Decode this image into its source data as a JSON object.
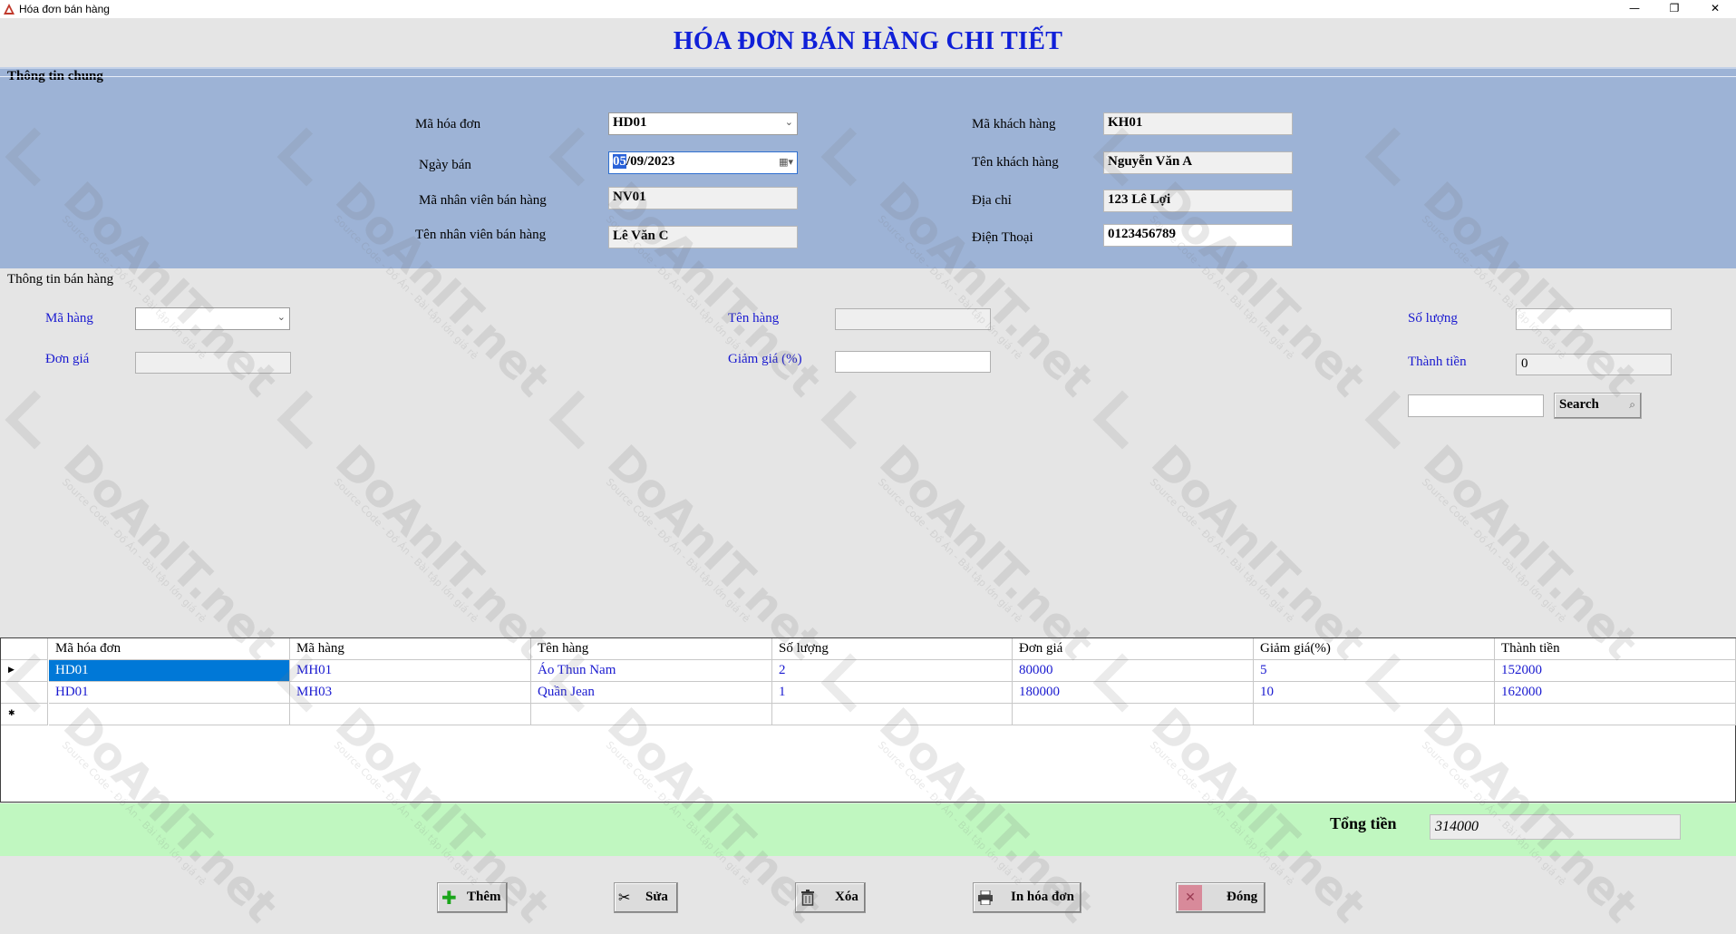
{
  "window": {
    "title": "Hóa đơn bán hàng",
    "minimize": "—",
    "restore": "❐",
    "close": "✕"
  },
  "form_title": "HÓA ĐƠN BÁN HÀNG CHI TIẾT",
  "general": {
    "group_title": "Thông tin chung",
    "invoice_id_label": "Mã hóa đơn",
    "invoice_id_value": "HD01",
    "sale_date_label": "Ngày bán",
    "sale_date_day": "05",
    "sale_date_rest": "/09/2023",
    "employee_id_label": "Mã nhân viên bán hàng",
    "employee_id_value": "NV01",
    "employee_name_label": "Tên nhân viên bán hàng",
    "employee_name_value": "Lê Văn C",
    "customer_id_label": "Mã khách hàng",
    "customer_id_value": "KH01",
    "customer_name_label": "Tên khách hàng",
    "customer_name_value": "Nguyễn Văn A",
    "address_label": "Địa chỉ",
    "address_value": "123 Lê Lợi",
    "phone_label": "Điện Thoại",
    "phone_value": "0123456789"
  },
  "sales": {
    "group_title": "Thông tin bán hàng",
    "product_id_label": "Mã hàng",
    "product_id_value": "",
    "product_name_label": "Tên hàng",
    "product_name_value": "",
    "quantity_label": "Số lượng",
    "quantity_value": "",
    "unit_price_label": "Đơn giá",
    "unit_price_value": "",
    "discount_label": "Giảm giá (%)",
    "discount_value": "",
    "line_total_label": "Thành tiền",
    "line_total_value": "0",
    "search_value": "",
    "search_button": "Search"
  },
  "grid": {
    "columns": [
      "Mã hóa đơn",
      "Mã hàng",
      "Tên hàng",
      "Số lượng",
      "Đơn giá",
      "Giảm giá(%)",
      "Thành tiền"
    ],
    "rows": [
      [
        "HD01",
        "MH01",
        "Áo Thun Nam",
        "2",
        "80000",
        "5",
        "152000"
      ],
      [
        "HD01",
        "MH03",
        "Quần Jean",
        "1",
        "180000",
        "10",
        "162000"
      ]
    ],
    "current_row_marker": "▶",
    "new_row_marker": "✱"
  },
  "total": {
    "label": "Tổng tiền",
    "value": "314000"
  },
  "buttons": {
    "add": "Thêm",
    "edit": "Sửa",
    "delete": "Xóa",
    "print": "In hóa đơn",
    "close": "Đóng"
  },
  "watermark": {
    "brand": "DoAnIT.net",
    "tagline": "Source Code - Đồ Án - Bài tập lớn giá rẻ"
  },
  "colors": {
    "title_blue": "#1020d8",
    "panel_blue": "#9db3d6",
    "total_green": "#c0f7c0",
    "selection_blue": "#0078d7",
    "add_icon": "#1aa51a",
    "close_icon_bg": "#d88a9a"
  },
  "icons": {
    "add": "plus-icon",
    "edit": "scissors-icon",
    "delete": "trash-icon",
    "print": "printer-icon",
    "close": "close-x-icon",
    "search": "magnifier-icon",
    "calendar": "calendar-icon",
    "dropdown": "chevron-down-icon"
  }
}
